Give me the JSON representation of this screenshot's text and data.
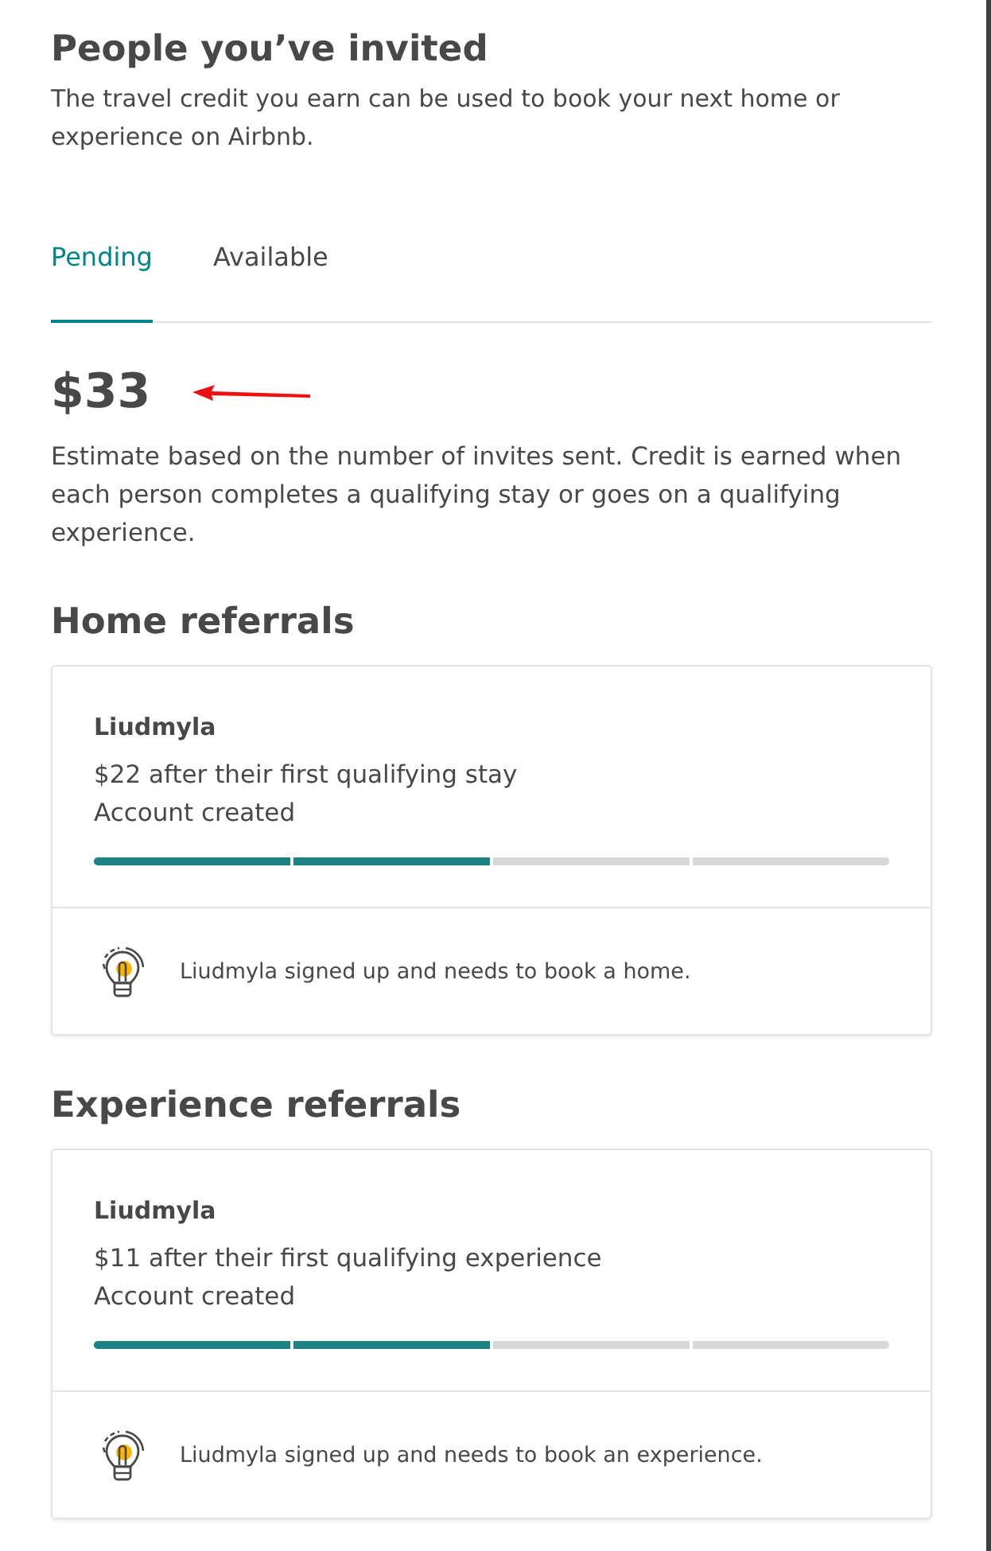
{
  "title": "People you’ve invited",
  "subtitle": "The travel credit you earn can be used to book your next home or experience on Airbnb.",
  "tabs": [
    {
      "label": "Pending",
      "selected": true
    },
    {
      "label": "Available",
      "selected": false
    }
  ],
  "amount": "$33",
  "estimate_note": "Estimate based on the number of invites sent. Credit is earned when each person completes a qualifying stay or goes on a qualifying experience.",
  "sections": [
    {
      "heading": "Home referrals",
      "referrals": [
        {
          "name": "Liudmyla",
          "reward": "$22 after their first qualifying stay",
          "status": "Account created",
          "level": 0.5,
          "tip": "Liudmyla signed up and needs to book a home."
        }
      ]
    },
    {
      "heading": "Experience referrals",
      "referrals": [
        {
          "name": "Liudmyla",
          "reward": "$11 after their first qualifying experience",
          "status": "Account created",
          "level": 0.5,
          "tip": "Liudmyla signed up and needs to book an experience."
        }
      ]
    }
  ]
}
